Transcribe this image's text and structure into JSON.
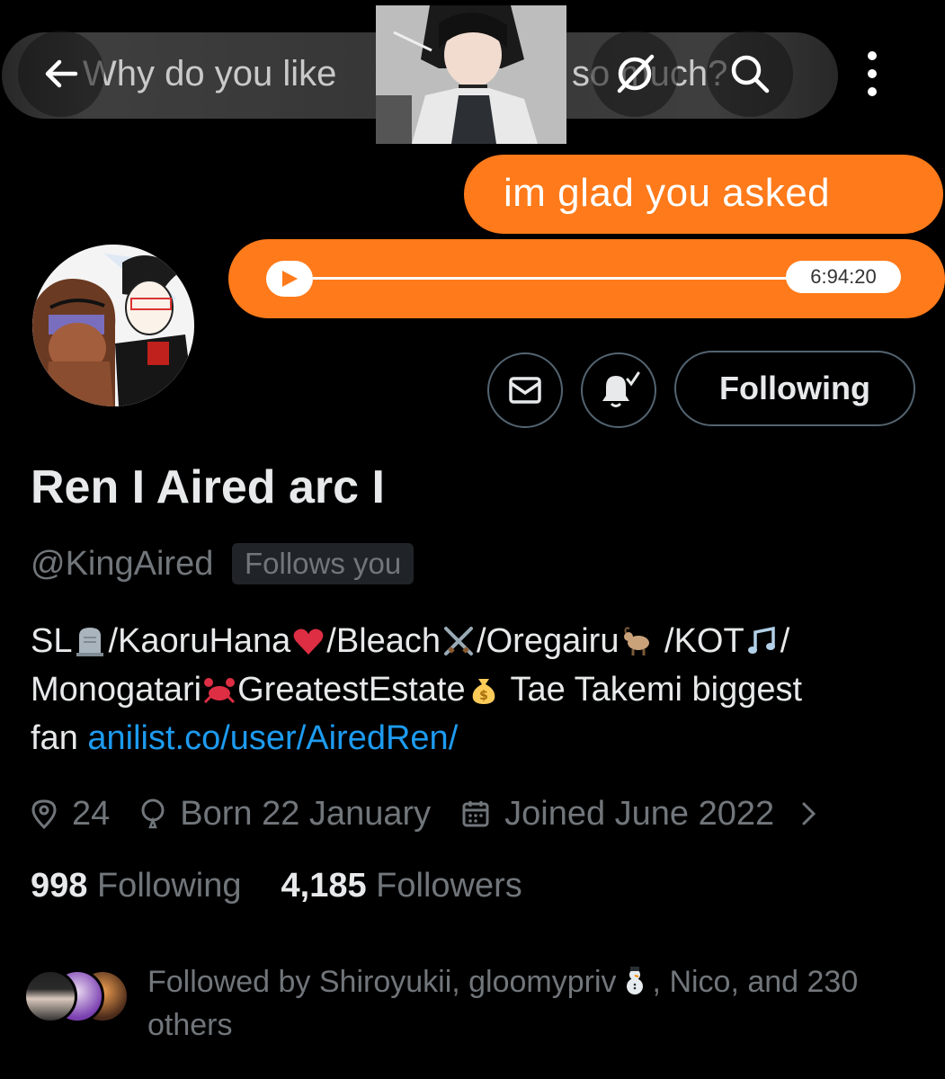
{
  "banner": {
    "gray_bubble_left_text": "Why do you like",
    "gray_bubble_right_text": "so much?",
    "orange_bubble_text": "im glad you asked",
    "voice_time": "6:94:20"
  },
  "nav": {
    "back_icon": "arrow-left-icon",
    "grok_icon": "grok-icon",
    "search_icon": "search-icon",
    "more_icon": "more-vertical-icon"
  },
  "actions": {
    "message_icon": "envelope-icon",
    "notify_icon": "bell-check-icon",
    "following_label": "Following"
  },
  "profile": {
    "display_name": "Ren I Aired arc I",
    "handle": "@KingAired",
    "follows_you": "Follows you",
    "bio": {
      "line1_parts": [
        "SL",
        "/KaoruHana",
        "/Bleach",
        "/Oregairu",
        " /KOT",
        "/"
      ],
      "line2_parts": [
        "Monogatari",
        "GreatestEstate",
        " Tae Takemi biggest"
      ],
      "line3_prefix": "fan ",
      "link": "anilist.co/user/AiredRen/"
    },
    "meta": {
      "location": "24",
      "birthday": "Born 22 January",
      "joined": "Joined June 2022"
    },
    "stats": {
      "following_count": "998",
      "following_label": "Following",
      "followers_count": "4,185",
      "followers_label": "Followers"
    },
    "followed_by": {
      "prefix": "Followed by Shiroyukii, gloomypriv",
      "suffix": ", Nico, and 230",
      "line2": "others"
    }
  },
  "colors": {
    "background": "#000000",
    "text_primary": "#e7e9ea",
    "text_secondary": "#71767b",
    "link": "#1d9bf0",
    "orange_bubble": "#ff7a1a",
    "border": "#536471"
  }
}
